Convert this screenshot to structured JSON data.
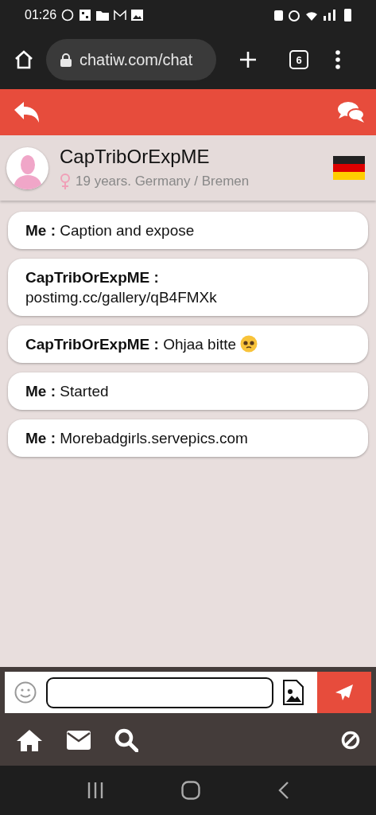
{
  "status_bar": {
    "time": "01:26"
  },
  "browser": {
    "url": "chatiw.com/chat",
    "tab_count": "6"
  },
  "profile": {
    "name": "CapTribOrExpME",
    "details": "19 years. Germany / Bremen"
  },
  "messages": [
    {
      "sender": "Me :",
      "text": "Caption and expose",
      "emoji": false
    },
    {
      "sender": "CapTribOrExpME :",
      "text": "postimg.cc/gallery/qB4FMXk",
      "emoji": false
    },
    {
      "sender": "CapTribOrExpME :",
      "text": "Ohjaa bitte",
      "emoji": true
    },
    {
      "sender": "Me :",
      "text": "Started",
      "emoji": false
    },
    {
      "sender": "Me :",
      "text": "Morebadgirls.servepics.com",
      "emoji": false
    }
  ]
}
